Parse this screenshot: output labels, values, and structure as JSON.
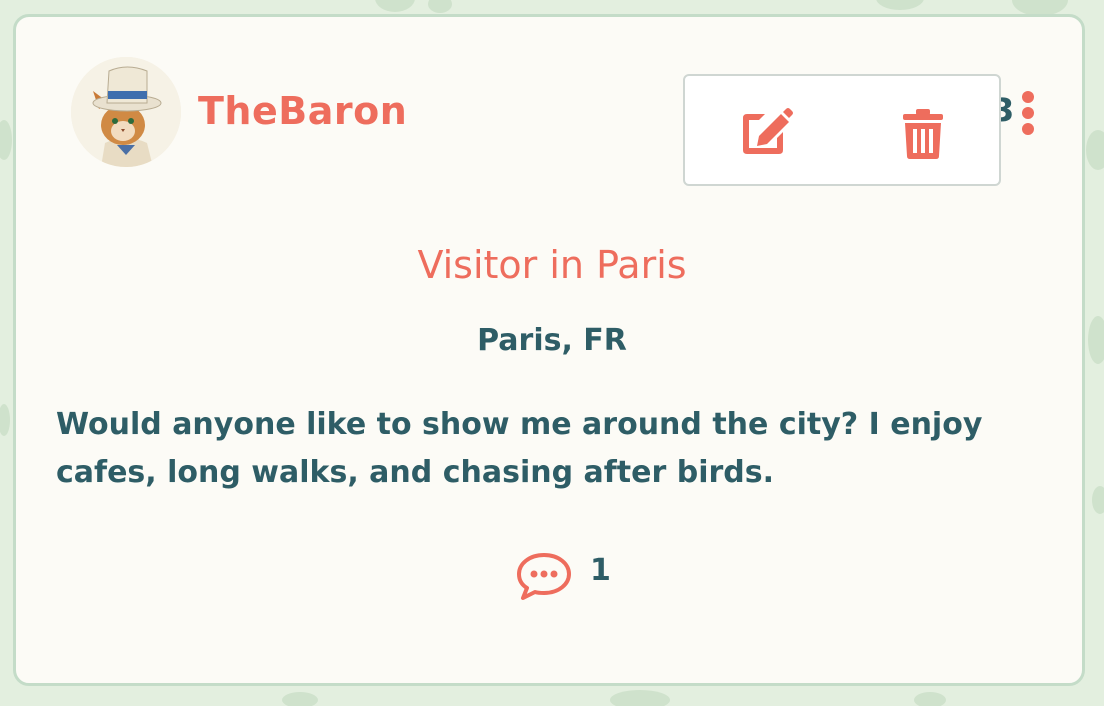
{
  "post": {
    "username": "TheBaron",
    "date_fragment": "3",
    "title": "Visitor in Paris",
    "location": "Paris, FR",
    "body": "Would anyone like to show me around the city? I enjoy cafes, long walks, and chasing after birds.",
    "comment_count": "1"
  },
  "menu": {
    "items": [
      {
        "name": "edit",
        "icon": "edit-icon"
      },
      {
        "name": "delete",
        "icon": "trash-icon"
      }
    ]
  },
  "colors": {
    "accent": "#ee6d5d",
    "text": "#2e5d66",
    "card_bg": "#fcfbf6",
    "page_bg": "#e3efdf"
  }
}
